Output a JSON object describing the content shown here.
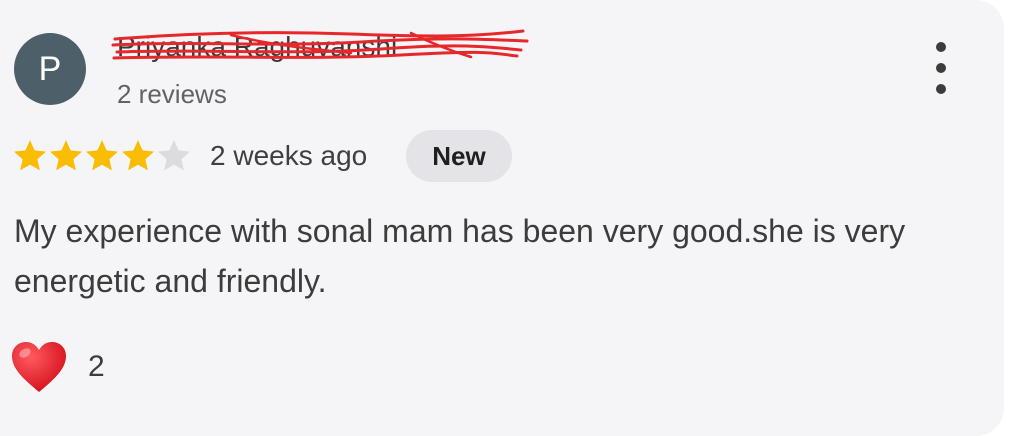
{
  "review": {
    "author": {
      "initial": "P",
      "name": "Priyanka Raghuvanshi",
      "review_count": "2 reviews"
    },
    "rating": {
      "value": 4,
      "max": 5
    },
    "time_ago": "2 weeks ago",
    "badge": "New",
    "text": "My experience with sonal mam has been very good.she is very energetic and friendly.",
    "reaction": {
      "icon": "heart-icon",
      "count": "2"
    }
  },
  "colors": {
    "card_background": "#f5f5f8",
    "avatar": "#4d6069",
    "star_filled": "#fbbc04",
    "star_empty": "#dadce0",
    "badge_background": "#e3e3e8",
    "redaction": "#e8272b",
    "heart": "#e0141e"
  }
}
